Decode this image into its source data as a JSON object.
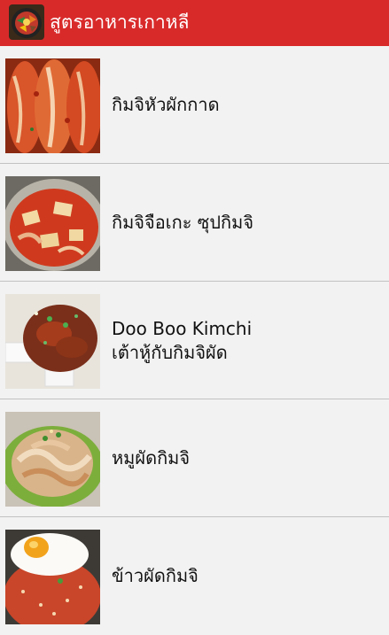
{
  "app": {
    "title": "สูตรอาหารเกาหลี",
    "icon": "bibimbap-app-icon"
  },
  "colors": {
    "appbar": "#d92a2a",
    "background": "#f2f2f2",
    "divider": "#c2c2c2",
    "text": "#111111"
  },
  "recipes": [
    {
      "title": "กิมจิหัวผักกาด",
      "subtitle": "",
      "thumbnail": "kimchi-cabbage-image"
    },
    {
      "title": "กิมจิจือเกะ ซุปกิมจิ",
      "subtitle": "",
      "thumbnail": "kimchi-stew-image"
    },
    {
      "title": "Doo Boo Kimchi",
      "subtitle": "เต้าหู้กับกิมจิผัด",
      "thumbnail": "tofu-kimchi-image"
    },
    {
      "title": "หมูผัดกิมจิ",
      "subtitle": "",
      "thumbnail": "pork-kimchi-image"
    },
    {
      "title": "ข้าวผัดกิมจิ",
      "subtitle": "",
      "thumbnail": "kimchi-fried-rice-image"
    }
  ]
}
